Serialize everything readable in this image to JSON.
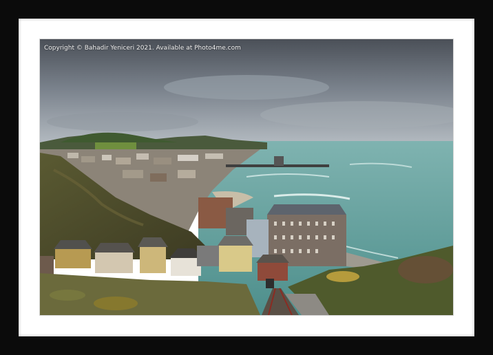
{
  "photo": {
    "copyright_text": "Copyright © Bahadir Yeniceri 2021. Available at Photo4me.com"
  },
  "colors": {
    "frame": "#0b0b0b",
    "mat": "#ffffff",
    "sea": "#5e9c98",
    "sky": "#6f7883"
  }
}
